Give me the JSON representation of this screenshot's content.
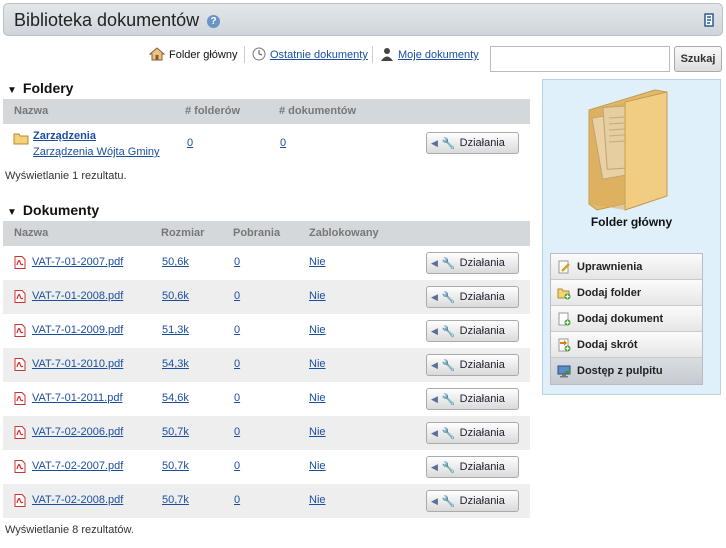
{
  "header": {
    "title": "Biblioteka dokumentów",
    "help": "?"
  },
  "nav": {
    "home": "Folder główny",
    "recent": "Ostatnie dokumenty",
    "mine": "Moje dokumenty"
  },
  "search": {
    "button": "Szukaj",
    "value": ""
  },
  "folders": {
    "title": "Foldery",
    "columns": [
      "Nazwa",
      "# folderów",
      "# dokumentów"
    ],
    "rows": [
      {
        "name": "Zarządzenia",
        "desc": "Zarządzenia Wójta Gminy",
        "folders": "0",
        "docs": "0",
        "action": "Działania"
      }
    ],
    "info": "Wyświetlanie 1 rezultatu."
  },
  "documents": {
    "title": "Dokumenty",
    "columns": [
      "Nazwa",
      "Rozmiar",
      "Pobrania",
      "Zablokowany"
    ],
    "rows": [
      {
        "name": "VAT-7-01-2007.pdf",
        "size": "50,6k",
        "downloads": "0",
        "locked": "Nie",
        "action": "Działania"
      },
      {
        "name": "VAT-7-01-2008.pdf",
        "size": "50,6k",
        "downloads": "0",
        "locked": "Nie",
        "action": "Działania"
      },
      {
        "name": "VAT-7-01-2009.pdf",
        "size": "51,3k",
        "downloads": "0",
        "locked": "Nie",
        "action": "Działania"
      },
      {
        "name": "VAT-7-01-2010.pdf",
        "size": "54,3k",
        "downloads": "0",
        "locked": "Nie",
        "action": "Działania"
      },
      {
        "name": "VAT-7-01-2011.pdf",
        "size": "54,6k",
        "downloads": "0",
        "locked": "Nie",
        "action": "Działania"
      },
      {
        "name": "VAT-7-02-2006.pdf",
        "size": "50,7k",
        "downloads": "0",
        "locked": "Nie",
        "action": "Działania"
      },
      {
        "name": "VAT-7-02-2007.pdf",
        "size": "50,7k",
        "downloads": "0",
        "locked": "Nie",
        "action": "Działania"
      },
      {
        "name": "VAT-7-02-2008.pdf",
        "size": "50,7k",
        "downloads": "0",
        "locked": "Nie",
        "action": "Działania"
      }
    ],
    "info": "Wyświetlanie 8 rezultatów."
  },
  "sidebar": {
    "folder_title": "Folder główny",
    "menu": [
      "Uprawnienia",
      "Dodaj folder",
      "Dodaj dokument",
      "Dodaj skrót",
      "Dostęp z pulpitu"
    ]
  }
}
